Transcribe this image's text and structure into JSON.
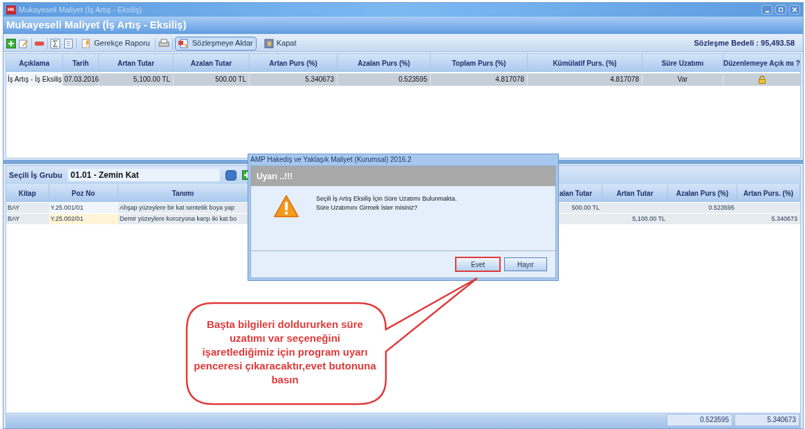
{
  "window": {
    "title": "Mukayeseli Maliyet (İş Artış - Eksiliş)",
    "app_icon": "HK"
  },
  "header": {
    "title": "Mukayeseli Maliyet (İş Artış - Eksiliş)"
  },
  "toolbar": {
    "buttons": [
      {
        "label": "Gerekçe Raporu",
        "selected": false
      },
      {
        "label": "Sözleşmeye Aktar",
        "selected": true
      },
      {
        "label": "Kapat",
        "selected": false
      }
    ],
    "contract_amount": "Sözleşme Bedeli : 95,493.58"
  },
  "table": {
    "columns": [
      "Açıklama",
      "Tarih",
      "Artan Tutar",
      "Azalan Tutar",
      "Artan Purs (%)",
      "Azalan Purs (%)",
      "Toplam Purs (%)",
      "Kümülatif Purs. (%)",
      "Süre Uzatımı",
      "Düzenlemeye Açık mı ?"
    ],
    "rows": [
      {
        "cells": [
          "İş Artış - İş Eksiliş",
          "07.03.2016",
          "5,100.00 TL",
          "500.00 TL",
          "5.340673",
          "0.523595",
          "4.817078",
          "4.817078",
          "Var"
        ],
        "locked": true
      }
    ]
  },
  "work_group": {
    "label": "Seçili İş Grubu",
    "value": "01.01 - Zemin Kat"
  },
  "items_table": {
    "left_columns": [
      "Kitap",
      "Poz No",
      "Tanımı"
    ],
    "right_columns": [
      "alan Tutar",
      "Artan Tutar",
      "Azalan Purs (%)",
      "Artan Purs. (%)"
    ],
    "rows": [
      {
        "left": [
          "BAY",
          "Y.25.001/01",
          "Ahşap yüzeylere bir kat sentetik boya yap"
        ],
        "right": {
          "azalan_tutar": "500.00 TL",
          "azalan_purs": "0.523595"
        },
        "selected": false
      },
      {
        "left": [
          "BAY",
          "Y.25.002/01",
          "Demir yüzeylere korozyona karşı iki kat bo"
        ],
        "right": {
          "artan_tutar": "5,100.00 TL",
          "artan_purs": "5.340673"
        },
        "selected": true
      }
    ],
    "totals": [
      "0.523595",
      "5.340673"
    ]
  },
  "dialog": {
    "title": "AMP Hakediş ve Yaklaşık Maliyet (Kurumsal) 2016.2",
    "heading": "Uyarı ..!!!",
    "message": [
      "Seçili İş Artış Eksiliş İçin Süre Uzatımı Bulunmakta.",
      "Süre Uzatımını Girmek İster misiniz?"
    ],
    "buttons": [
      {
        "label": "Evet",
        "selected": true
      },
      {
        "label": "Hayır",
        "selected": false
      }
    ]
  },
  "callout": {
    "text": "Başta bilgileri doldururken süre uzatımı var seçeneğini işaretlediğimiz için program uyarı penceresi çıkaracaktır,evet butonuna basın"
  }
}
